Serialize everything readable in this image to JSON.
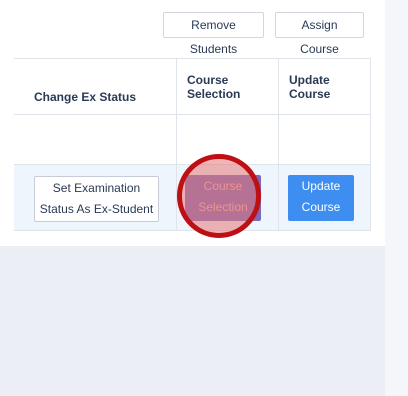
{
  "toolbar": {
    "remove_students_label": "Remove Students",
    "assign_course_label": "Assign Course"
  },
  "table": {
    "headers": {
      "change_ex_status": "Change Ex Status",
      "course_selection": [
        "Course",
        "Selection"
      ],
      "update_course": [
        "Update",
        "Course"
      ]
    },
    "row": {
      "ex_status_button": [
        "Set Examination",
        "Status As Ex-Student"
      ],
      "course_selection_button": [
        "Course",
        "Selection"
      ],
      "update_course_button": [
        "Update",
        "Course"
      ]
    }
  },
  "colors": {
    "course_selection_button_bg": "#7a6ab8",
    "update_course_button_bg": "#3d8ef0",
    "highlight_ring": "#be0f14"
  }
}
